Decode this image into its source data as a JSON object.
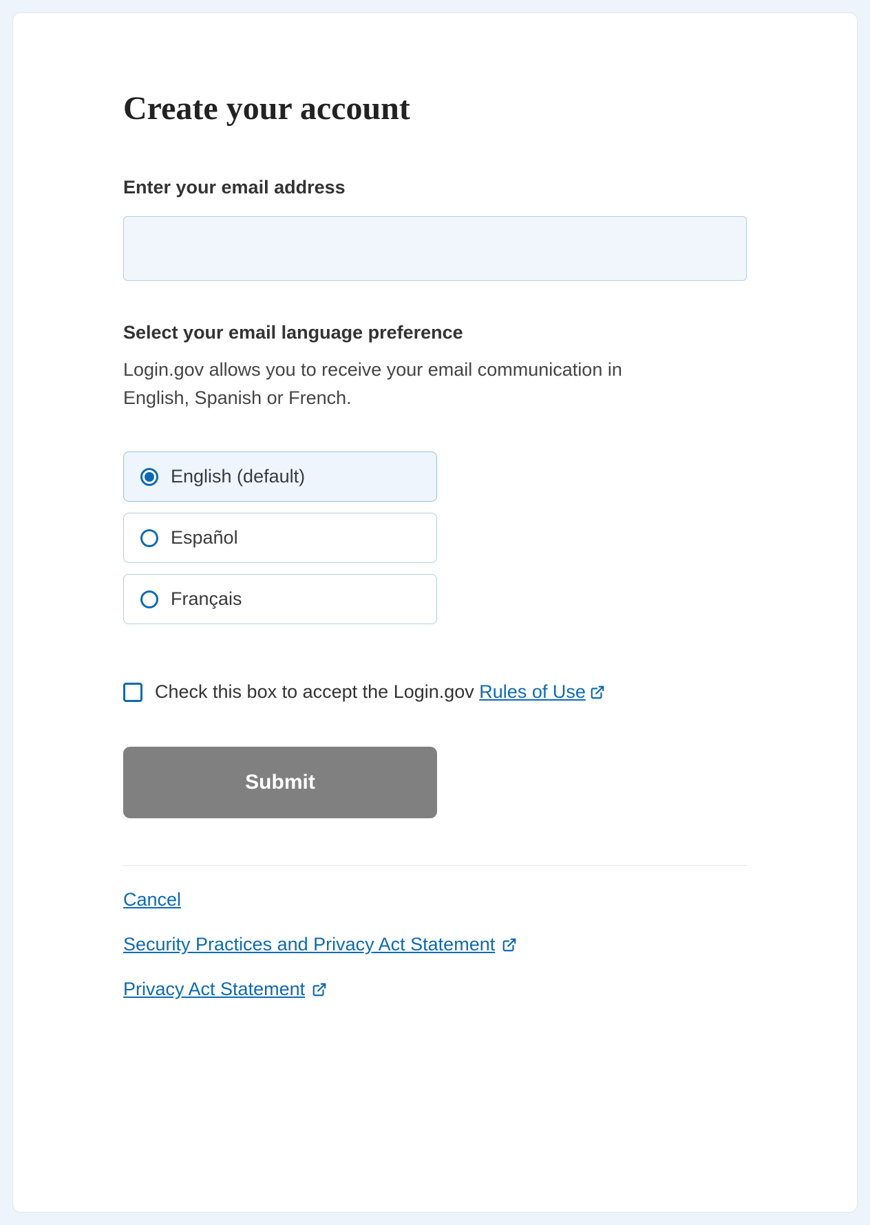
{
  "title": "Create your account",
  "email": {
    "label": "Enter your email address",
    "value": ""
  },
  "language": {
    "section_title": "Select your email language preference",
    "helper_text": "Login.gov allows you to receive your email communication in English, Spanish or French.",
    "options": [
      {
        "label": "English (default)",
        "selected": true
      },
      {
        "label": "Español",
        "selected": false
      },
      {
        "label": "Français",
        "selected": false
      }
    ]
  },
  "consent": {
    "prefix": "Check this box to accept the Login.gov ",
    "link_label": "Rules of Use",
    "checked": false
  },
  "buttons": {
    "submit": "Submit"
  },
  "links": {
    "cancel": "Cancel",
    "security": "Security Practices and Privacy Act Statement",
    "privacy": "Privacy Act Statement"
  },
  "colors": {
    "link": "#0d6ab3",
    "page_bg": "#eef4fb",
    "card_bg": "#ffffff",
    "submit_bg": "#808080"
  }
}
